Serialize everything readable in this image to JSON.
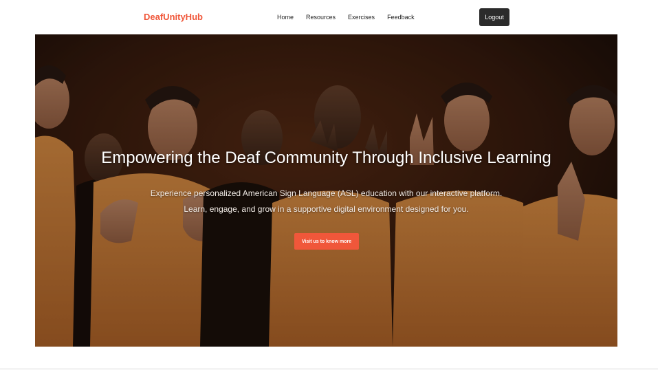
{
  "navbar": {
    "brand": "DeafUnityHub",
    "links": [
      "Home",
      "Resources",
      "Exercises",
      "Feedback"
    ],
    "logout_label": "Logout"
  },
  "hero": {
    "title": "Empowering the Deaf Community Through Inclusive Learning",
    "subtitle_line1": "Experience personalized American Sign Language (ASL) education with our interactive platform.",
    "subtitle_line2": "Learn, engage, and grow in a supportive digital environment designed for you.",
    "cta_label": "Visit us to know more",
    "image": "group-signing-photo"
  },
  "colors": {
    "accent": "#f0573a",
    "dark_button": "#2b2b2b",
    "shirt_orange": "#d9823a"
  }
}
